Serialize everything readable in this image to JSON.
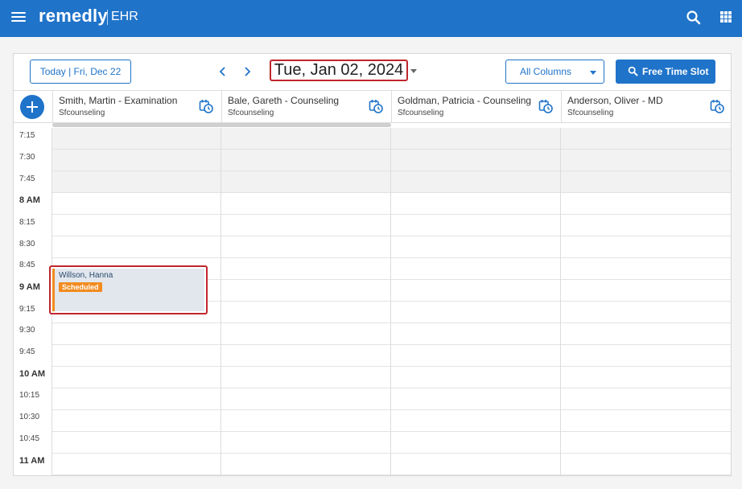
{
  "app": {
    "brand": "remedly",
    "brand_sub": "EHR"
  },
  "toolbar": {
    "today_label": "Today | Fri, Dec 22",
    "current_date": "Tue, Jan 02, 2024",
    "columns_select": "All Columns",
    "free_time_label": "Free Time Slot"
  },
  "columns": [
    {
      "name": "Smith, Martin - Examination",
      "org": "Sfcounseling"
    },
    {
      "name": "Bale, Gareth - Counseling",
      "org": "Sfcounseling"
    },
    {
      "name": "Goldman, Patricia - Counseling",
      "org": "Sfcounseling"
    },
    {
      "name": "Anderson, Oliver - MD",
      "org": "Sfcounseling"
    }
  ],
  "time_slots": [
    "7:15",
    "7:30",
    "7:45",
    "8 AM",
    "8:15",
    "8:30",
    "8:45",
    "9 AM",
    "9:15",
    "9:30",
    "9:45",
    "10 AM",
    "10:15",
    "10:30",
    "10:45",
    "11 AM"
  ],
  "appointment": {
    "patient": "Willson, Hanna",
    "status": "Scheduled"
  },
  "colors": {
    "accent": "#1f73c9",
    "highlight": "#c0262d",
    "status_scheduled": "#f28c1f"
  },
  "icons": [
    "menu-icon",
    "search-icon",
    "apps-grid-icon",
    "chevron-left-icon",
    "chevron-right-icon",
    "search-icon",
    "plus-icon",
    "calendar-clock-icon"
  ]
}
